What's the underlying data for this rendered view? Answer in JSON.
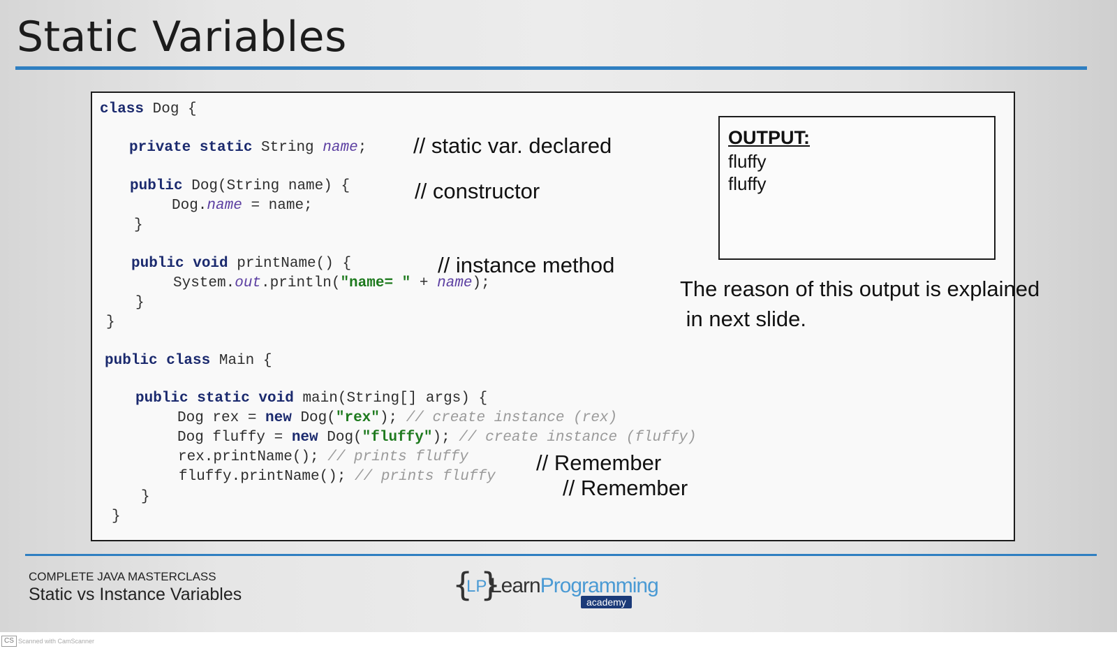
{
  "slide": {
    "title": "Static Variables",
    "code": {
      "l1": [
        "class",
        " Dog {"
      ],
      "l2": [
        "private static",
        " String ",
        "name",
        ";"
      ],
      "l3": [
        "public",
        " Dog(String name) {"
      ],
      "l4": [
        "Dog.",
        "name",
        " = name;"
      ],
      "l5": "}",
      "l6": [
        "public void",
        " printName() {"
      ],
      "l7": [
        "System.",
        "out",
        ".println(",
        "\"name= \"",
        " + ",
        "name",
        ");"
      ],
      "l8": "}",
      "l9": "}",
      "l10": [
        "public class",
        " Main {"
      ],
      "l11": [
        "public static void",
        " main(String[] args) {"
      ],
      "l12": [
        "Dog rex = ",
        "new",
        " Dog(",
        "\"rex\"",
        "); ",
        "// create instance (rex)"
      ],
      "l13": [
        "Dog fluffy = ",
        "new",
        " Dog(",
        "\"fluffy\"",
        "); ",
        "// create instance (fluffy)"
      ],
      "l14": [
        "rex.printName(); ",
        "// prints fluffy"
      ],
      "l15": [
        "fluffy.printName(); ",
        "// prints fluffy"
      ],
      "l16": "}",
      "l17": "}"
    },
    "notes": {
      "static_var": "// static var. declared",
      "constructor": "// constructor",
      "instance_method": "// instance method",
      "remember1": "// Remember",
      "remember2": "// Remember"
    },
    "output": {
      "title": "OUTPUT:",
      "lines": [
        "fluffy",
        "fluffy"
      ]
    },
    "explanation": {
      "line1": "The reason of this output is explained",
      "line2": " in next slide."
    },
    "footer": {
      "course": "COMPLETE JAVA MASTERCLASS",
      "topic": "Static vs Instance Variables",
      "logo": {
        "brace_left": "{",
        "lp": "LP",
        "brace_right": "}",
        "learn": "Learn",
        "programming": "Programming",
        "academy": "academy"
      }
    }
  },
  "scanner": {
    "badge": "CS",
    "text": "Scanned with CamScanner"
  }
}
